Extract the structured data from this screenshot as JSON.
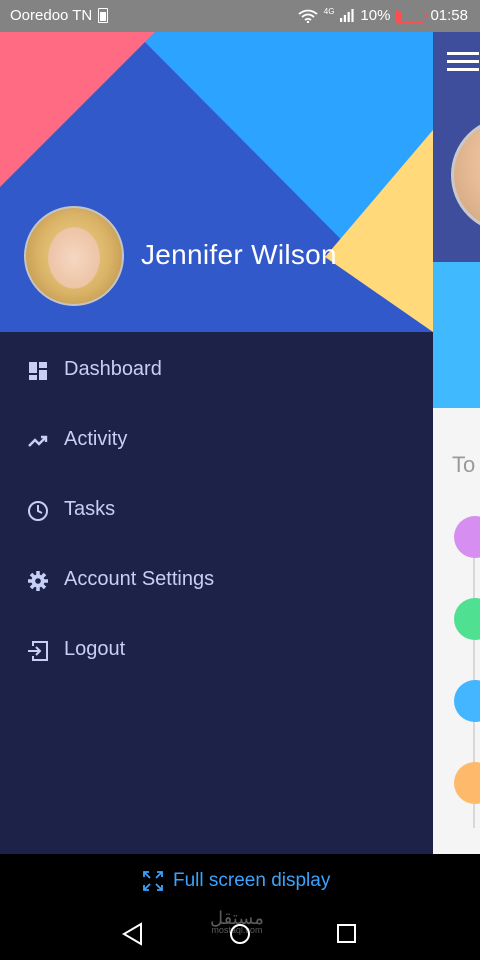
{
  "status_bar": {
    "carrier": "Ooredoo TN",
    "network": "4G",
    "battery_percent": "10%",
    "time": "01:58"
  },
  "drawer": {
    "user_name": "Jennifer Wilson",
    "items": [
      {
        "label": "Dashboard",
        "icon": "dashboard-icon"
      },
      {
        "label": "Activity",
        "icon": "trending-up-icon"
      },
      {
        "label": "Tasks",
        "icon": "clock-icon"
      },
      {
        "label": "Account Settings",
        "icon": "gear-icon"
      },
      {
        "label": "Logout",
        "icon": "logout-icon"
      }
    ]
  },
  "background_screen": {
    "partial_text": "To"
  },
  "bottom_bar": {
    "fullscreen_label": "Full screen display",
    "watermark": "مستقل",
    "watermark_sub": "mostaql.com"
  },
  "colors": {
    "drawer_bg": "#1d2249",
    "header_blue": "#3159c9",
    "header_light_blue": "#2ba3ff",
    "header_pink": "#ff6b82",
    "header_yellow": "#ffd97a",
    "nav_text": "#c7cff7",
    "dot_purple": "#d68ef0",
    "dot_green": "#4fe092",
    "dot_blue": "#43b6ff",
    "dot_orange": "#ffb96b"
  }
}
